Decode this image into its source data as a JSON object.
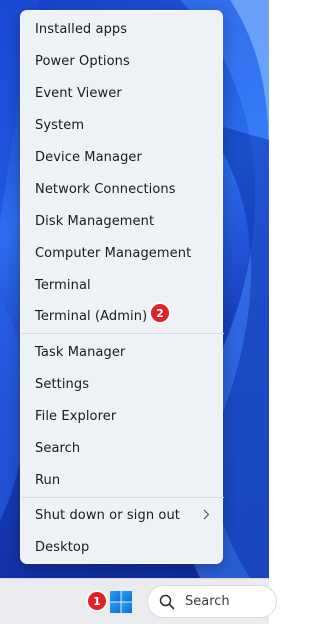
{
  "menu": {
    "items": [
      {
        "label": "Installed apps"
      },
      {
        "label": "Power Options"
      },
      {
        "label": "Event Viewer"
      },
      {
        "label": "System"
      },
      {
        "label": "Device Manager"
      },
      {
        "label": "Network Connections"
      },
      {
        "label": "Disk Management"
      },
      {
        "label": "Computer Management"
      },
      {
        "label": "Terminal"
      },
      {
        "label": "Terminal (Admin)"
      },
      {
        "label": "Task Manager"
      },
      {
        "label": "Settings"
      },
      {
        "label": "File Explorer"
      },
      {
        "label": "Search"
      },
      {
        "label": "Run"
      },
      {
        "label": "Shut down or sign out",
        "submenu_icon": "chevron-right-icon"
      },
      {
        "label": "Desktop"
      }
    ]
  },
  "badges": {
    "step1": "1",
    "step2": "2",
    "color": "#e02128"
  },
  "taskbar": {
    "start_icon": "windows-logo-icon",
    "search_placeholder": "Search",
    "search_icon": "search-icon"
  },
  "colors": {
    "accent": "#0067c0",
    "menu_background": "#eef1f6",
    "taskbar_background": "#e9ebef"
  }
}
